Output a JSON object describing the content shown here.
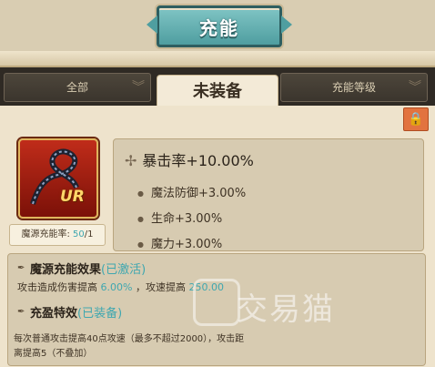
{
  "header": {
    "title": "充能"
  },
  "tabs": [
    {
      "label": "全部"
    },
    {
      "label": "未装备"
    },
    {
      "label": "充能等级"
    }
  ],
  "item": {
    "rarity": "UR",
    "charge_label": "魔源充能率:",
    "charge_current": "50",
    "charge_total": "/1"
  },
  "stats": {
    "main": "暴击率+10.00%",
    "subs": [
      "魔法防御+3.00%",
      "生命+3.00%",
      "魔力+3.00%"
    ]
  },
  "effects": {
    "charge_title": "魔源充能效果",
    "charge_tag": "(已激活)",
    "charge_desc_prefix": "攻击造成伤害提高",
    "charge_desc_val1": "6.00%",
    "charge_desc_mid": "，攻速提高",
    "charge_desc_val2": "250.00",
    "special_title": "充盈特效",
    "special_tag": "(已装备)",
    "special_line1": "每次普通攻击提高40点攻速（最多不超过2000），攻击距",
    "special_line2": "离提高5（不叠加）"
  },
  "watermark": "交易猫",
  "colors": {
    "accent": "#3fa7b0",
    "lock": "#e2733f",
    "banner": "#4f9ea0"
  }
}
